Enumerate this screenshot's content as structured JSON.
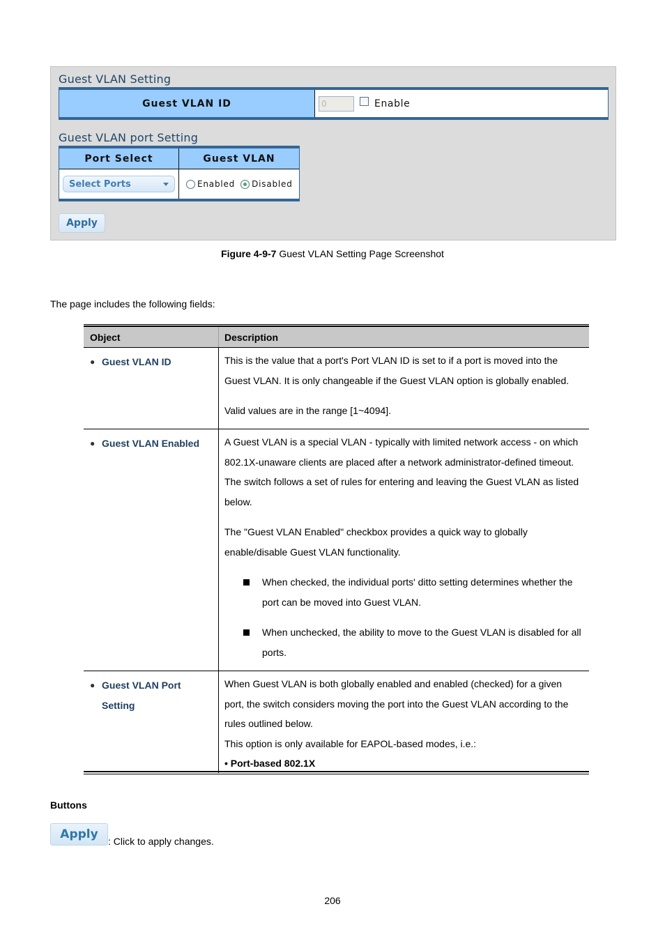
{
  "screenshot": {
    "guest_vlan_setting": {
      "title": "Guest VLAN Setting",
      "field_label": "Guest VLAN ID",
      "vlan_id_value": "0",
      "enable_label": "Enable",
      "enable_checked": false
    },
    "port_setting": {
      "title": "Guest VLAN port Setting",
      "headers": [
        "Port Select",
        "Guest VLAN"
      ],
      "select_value": "Select Ports",
      "radio_enabled_label": "Enabled",
      "radio_disabled_label": "Disabled",
      "selected": "Disabled"
    },
    "apply_label": "Apply"
  },
  "caption": {
    "figure_label": "Figure 4-9-7",
    "text": " Guest VLAN Setting Page Screenshot"
  },
  "intro": "The page includes the following fields:",
  "table": {
    "headers": {
      "object": "Object",
      "description": "Description"
    },
    "rows": [
      {
        "object": "Guest VLAN ID",
        "paragraphs": [
          "This is the value that a port's Port VLAN ID is set to if a port is moved into the Guest VLAN. It is only changeable if the Guest VLAN option is globally enabled.",
          "Valid values are in the range [1~4094]."
        ]
      },
      {
        "object": "Guest VLAN Enabled",
        "paragraphs": [
          "A Guest VLAN is a special VLAN - typically with limited network access - on which 802.1X-unaware clients are placed after a network administrator-defined timeout. The switch follows a set of rules for entering and leaving the Guest VLAN as listed below.",
          "The \"Guest VLAN Enabled\" checkbox provides a quick way to globally enable/disable Guest VLAN functionality."
        ],
        "bullets": [
          "When checked, the individual ports' ditto setting determines whether the port can be moved into Guest VLAN.",
          "When unchecked, the ability to move to the Guest VLAN is disabled for all ports."
        ]
      },
      {
        "object": "Guest VLAN Port Setting",
        "paragraphs": [
          "When Guest VLAN is both globally enabled and enabled (checked) for a given port, the switch considers moving the port into the Guest VLAN according to the rules outlined below.",
          "This option is only available for EAPOL-based modes, i.e.:"
        ],
        "bold_item": "• Port-based 802.1X"
      }
    ]
  },
  "buttons_section": {
    "title": "Buttons",
    "apply_label": "Apply",
    "apply_desc": ": Click to apply changes."
  },
  "page_number": "206"
}
